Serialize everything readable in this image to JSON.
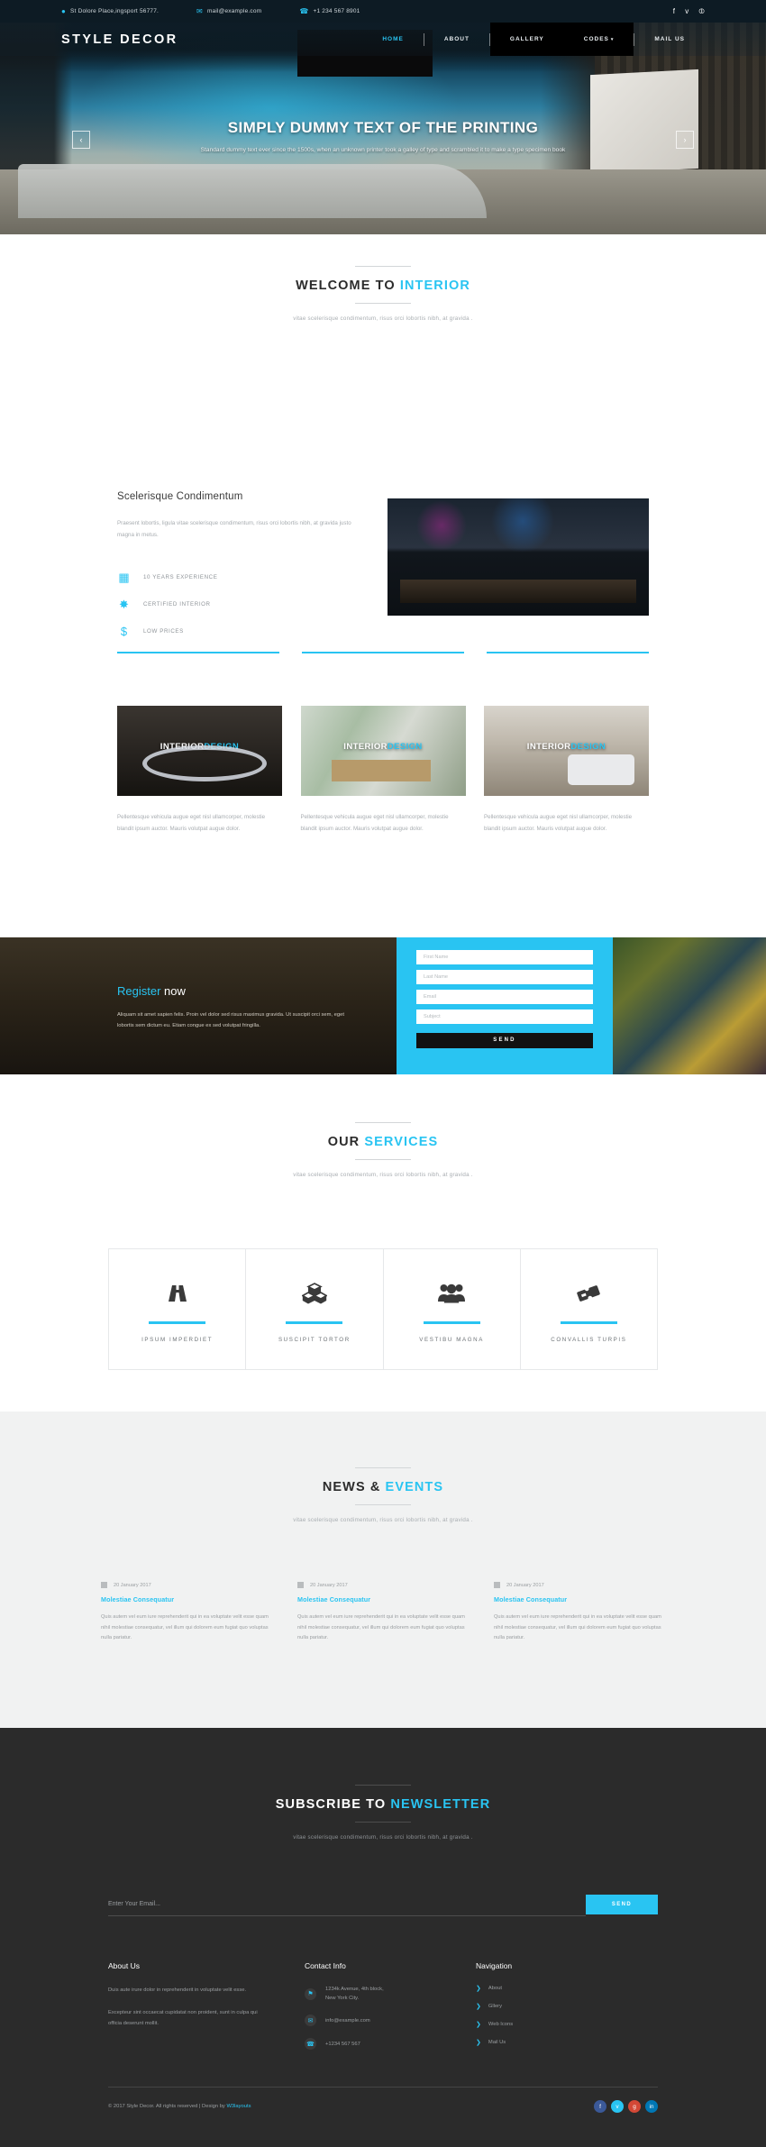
{
  "topbar": {
    "address": "St Dolore Place,ingsport 56777.",
    "email": "mail@example.com",
    "phone": "+1 234 567 8901",
    "address_icon": "location-pin-icon",
    "email_icon": "envelope-icon",
    "phone_icon": "phone-icon",
    "social": [
      {
        "name": "facebook-icon",
        "glyph": "f"
      },
      {
        "name": "twitter-icon",
        "glyph": "ᴠ"
      },
      {
        "name": "rss-icon",
        "glyph": "⦷"
      }
    ]
  },
  "nav": {
    "logo": "STYLE DECOR",
    "items": [
      {
        "label": "HOME",
        "active": true
      },
      {
        "label": "ABOUT",
        "active": false
      },
      {
        "label": "GALLERY",
        "active": false
      },
      {
        "label": "CODES",
        "active": false,
        "caret": "▾"
      },
      {
        "label": "MAIL US",
        "active": false
      }
    ]
  },
  "hero": {
    "title": "SIMPLY DUMMY TEXT OF THE PRINTING",
    "subtitle": "Standard dummy text ever since the 1500s, when an unknown printer took a galley of type and scrambled it to make a type specimen book",
    "prev_label": "‹",
    "next_label": "›"
  },
  "welcome": {
    "title_plain": "WELCOME TO ",
    "title_hl": "INTERIOR",
    "desc": "vitae scelerisque condimentum, risus orci lobortis nibh, at gravida ."
  },
  "about": {
    "heading": "Scelerisque Condimentum",
    "paragraph": "Praesent lobortis, ligula vitae scelerisque condimentum, risus orci lobortis nibh, at gravida justo magna in metus.",
    "features": [
      {
        "icon": "calendar-grid-icon",
        "glyph": "▦",
        "label": "10 YEARS EXPERIENCE"
      },
      {
        "icon": "badge-certified-icon",
        "glyph": "✸",
        "label": "CERTIFIED INTERIOR"
      },
      {
        "icon": "dollar-price-icon",
        "glyph": "$",
        "label": "LOW PRICES"
      }
    ],
    "image_alt": "city-bar-interior-photo"
  },
  "cards": [
    {
      "label_plain": "INTERIOR",
      "label_hl": "DESIGN",
      "text": "Pellentesque vehicula augue eget nisl ullamcorper, molestie blandit ipsum auctor. Mauris volutpat augue dolor.",
      "image_alt": "chandelier-showroom-photo"
    },
    {
      "label_plain": "INTERIOR",
      "label_hl": "DESIGN",
      "text": "Pellentesque vehicula augue eget nisl ullamcorper, molestie blandit ipsum auctor. Mauris volutpat augue dolor.",
      "image_alt": "glass-partition-room-photo"
    },
    {
      "label_plain": "INTERIOR",
      "label_hl": "DESIGN",
      "text": "Pellentesque vehicula augue eget nisl ullamcorper, molestie blandit ipsum auctor. Mauris volutpat augue dolor.",
      "image_alt": "white-lounge-photo"
    }
  ],
  "register": {
    "title_hl": "Register",
    "title_plain": " now",
    "paragraph": "Aliquam sit amet sapien felis. Proin vel dolor sed risus maximus gravida. Ut suscipit orci sem, eget lobortis sem dictum eu. Etiam congue ex sed volutpat fringilla.",
    "fields": [
      {
        "name": "first-name-input",
        "placeholder": "First Name",
        "value": ""
      },
      {
        "name": "last-name-input",
        "placeholder": "Last Name",
        "value": ""
      },
      {
        "name": "email-input",
        "placeholder": "Email",
        "value": ""
      },
      {
        "name": "subject-input",
        "placeholder": "Subject",
        "value": ""
      }
    ],
    "send_label": "SEND"
  },
  "services": {
    "title_plain": "OUR ",
    "title_hl": "SERVICES",
    "desc": "vitae scelerisque condimentum, risus orci lobortis nibh, at gravida .",
    "items": [
      {
        "icon": "road-icon",
        "label": "IPSUM IMPERDIET"
      },
      {
        "icon": "boxes-stack-icon",
        "label": "SUSCIPIT TORTOR"
      },
      {
        "icon": "users-group-icon",
        "label": "VESTIBU MAGNA"
      },
      {
        "icon": "ticket-icon",
        "label": "CONVALLIS TURPIS"
      }
    ]
  },
  "news": {
    "title_plain": "NEWS & ",
    "title_hl": "EVENTS",
    "desc": "vitae scelerisque condimentum, risus orci lobortis nibh, at gravida .",
    "items": [
      {
        "date": "20 January 2017",
        "title": "Molestiae Consequatur",
        "text": "Quis autem vel eum iure reprehenderit qui in ea voluptate velit esse quam nihil molestiae consequatur, vel illum qui dolorem eum fugiat quo voluptas nulla pariatur."
      },
      {
        "date": "20 January 2017",
        "title": "Molestiae Consequatur",
        "text": "Quis autem vel eum iure reprehenderit qui in ea voluptate velit esse quam nihil molestiae consequatur, vel illum qui dolorem eum fugiat quo voluptas nulla pariatur."
      },
      {
        "date": "20 January 2017",
        "title": "Molestiae Consequatur",
        "text": "Quis autem vel eum iure reprehenderit qui in ea voluptate velit esse quam nihil molestiae consequatur, vel illum qui dolorem eum fugiat quo voluptas nulla pariatur."
      }
    ]
  },
  "newsletter": {
    "title_plain": "SUBSCRIBE TO ",
    "title_hl": "NEWSLETTER",
    "desc": "vitae scelerisque condimentum, risus orci lobortis nibh, at gravida .",
    "placeholder": "Enter Your Email...",
    "value": "",
    "send_label": "SEND"
  },
  "footer": {
    "about": {
      "heading": "About Us",
      "p1": "Duis aute irure dolor in reprehenderit in voluptate velit esse.",
      "p2": "Excepteur sint occaecat cupidatat non proident, sunt in culpa qui officia deserunt mollit."
    },
    "contact": {
      "heading": "Contact Info",
      "items": [
        {
          "icon": "location-pin-icon",
          "glyph": "⚑",
          "text": "1234k Avenue, 4th block,\nNew York City."
        },
        {
          "icon": "envelope-icon",
          "glyph": "✉",
          "text": "info@example.com"
        },
        {
          "icon": "phone-icon",
          "glyph": "☎",
          "text": "+1234 567 567"
        }
      ]
    },
    "navigation": {
      "heading": "Navigation",
      "items": [
        "About",
        "Gllery",
        "Web Icons",
        "Mail Us"
      ]
    },
    "copyright_plain": "© 2017 Style Decor. All rights reserved | Design by ",
    "copyright_hl": "W3layouts",
    "social": [
      {
        "name": "facebook-icon",
        "glyph": "f",
        "cls": "fb"
      },
      {
        "name": "twitter-icon",
        "glyph": "ᴠ",
        "cls": "tw"
      },
      {
        "name": "google-plus-icon",
        "glyph": "g",
        "cls": "gp"
      },
      {
        "name": "linkedin-icon",
        "glyph": "in",
        "cls": "li"
      }
    ]
  },
  "colors": {
    "accent": "#29c4f2",
    "dark": "#2b2b2b",
    "topbar": "#0d1b24"
  }
}
